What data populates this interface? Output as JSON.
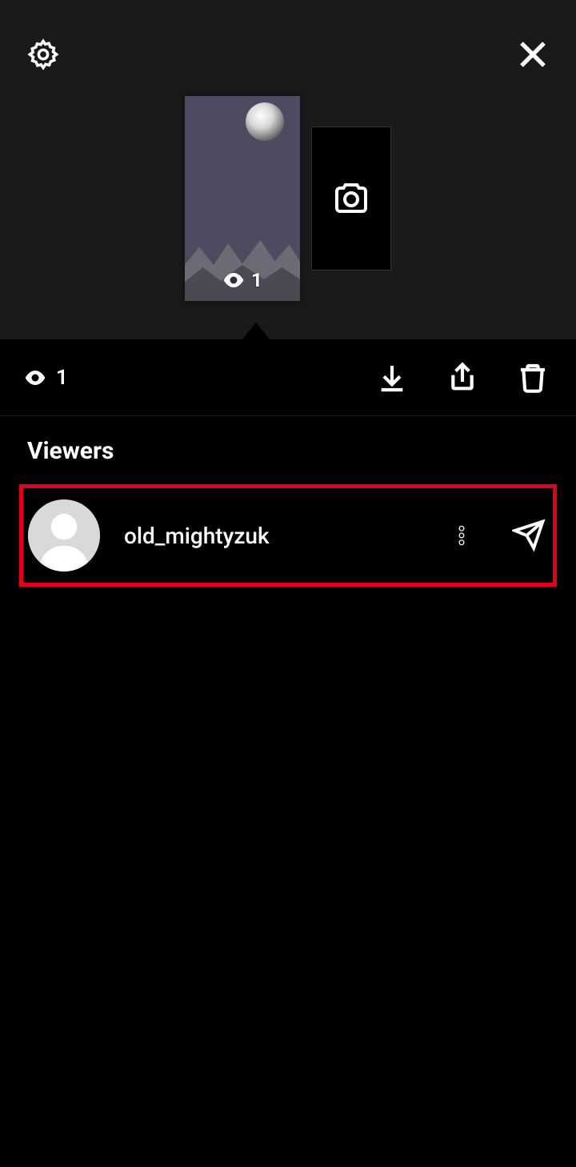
{
  "story": {
    "views_thumbnail": "1",
    "views_bar": "1"
  },
  "viewers": {
    "heading": "Viewers",
    "items": [
      {
        "username": "old_mightyzuk"
      }
    ]
  }
}
